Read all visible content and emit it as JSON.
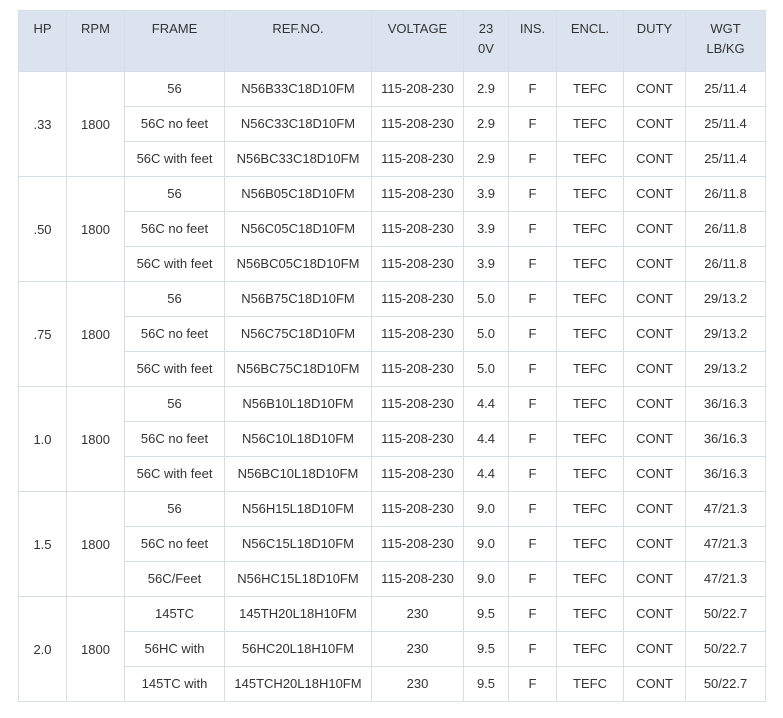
{
  "headers": [
    "HP",
    "RPM",
    "FRAME",
    "REF.NO.",
    "VOLTAGE",
    "230V",
    "INS.",
    "ENCL.",
    "DUTY",
    "WGT LB/KG"
  ],
  "header_display": {
    "hp": "HP",
    "rpm": "RPM",
    "frame": "FRAME",
    "ref": "REF.NO.",
    "voltage": "VOLTAGE",
    "amps_line1": "23",
    "amps_line2": "0V",
    "ins": "INS.",
    "encl": "ENCL.",
    "duty": "DUTY",
    "wgt_line1": "WGT",
    "wgt_line2": "LB/KG"
  },
  "groups": [
    {
      "hp": ".33",
      "rpm": "1800",
      "rows": [
        {
          "frame": "56",
          "ref": "N56B33C18D10FM",
          "voltage": "115-208-230",
          "amps": "2.9",
          "ins": "F",
          "encl": "TEFC",
          "duty": "CONT",
          "wgt": "25/11.4"
        },
        {
          "frame": "56C no feet",
          "ref": "N56C33C18D10FM",
          "voltage": "115-208-230",
          "amps": "2.9",
          "ins": "F",
          "encl": "TEFC",
          "duty": "CONT",
          "wgt": "25/11.4"
        },
        {
          "frame": "56C with feet",
          "ref": "N56BC33C18D10FM",
          "voltage": "115-208-230",
          "amps": "2.9",
          "ins": "F",
          "encl": "TEFC",
          "duty": "CONT",
          "wgt": "25/11.4"
        }
      ]
    },
    {
      "hp": ".50",
      "rpm": "1800",
      "rows": [
        {
          "frame": "56",
          "ref": "N56B05C18D10FM",
          "voltage": "115-208-230",
          "amps": "3.9",
          "ins": "F",
          "encl": "TEFC",
          "duty": "CONT",
          "wgt": "26/11.8"
        },
        {
          "frame": "56C no feet",
          "ref": "N56C05C18D10FM",
          "voltage": "115-208-230",
          "amps": "3.9",
          "ins": "F",
          "encl": "TEFC",
          "duty": "CONT",
          "wgt": "26/11.8"
        },
        {
          "frame": "56C with feet",
          "ref": "N56BC05C18D10FM",
          "voltage": "115-208-230",
          "amps": "3.9",
          "ins": "F",
          "encl": "TEFC",
          "duty": "CONT",
          "wgt": "26/11.8"
        }
      ]
    },
    {
      "hp": ".75",
      "rpm": "1800",
      "rows": [
        {
          "frame": "56",
          "ref": "N56B75C18D10FM",
          "voltage": "115-208-230",
          "amps": "5.0",
          "ins": "F",
          "encl": "TEFC",
          "duty": "CONT",
          "wgt": "29/13.2"
        },
        {
          "frame": "56C no feet",
          "ref": "N56C75C18D10FM",
          "voltage": "115-208-230",
          "amps": "5.0",
          "ins": "F",
          "encl": "TEFC",
          "duty": "CONT",
          "wgt": "29/13.2"
        },
        {
          "frame": "56C with feet",
          "ref": "N56BC75C18D10FM",
          "voltage": "115-208-230",
          "amps": "5.0",
          "ins": "F",
          "encl": "TEFC",
          "duty": "CONT",
          "wgt": "29/13.2"
        }
      ]
    },
    {
      "hp": "1.0",
      "rpm": "1800",
      "rows": [
        {
          "frame": "56",
          "ref": "N56B10L18D10FM",
          "voltage": "115-208-230",
          "amps": "4.4",
          "ins": "F",
          "encl": "TEFC",
          "duty": "CONT",
          "wgt": "36/16.3"
        },
        {
          "frame": "56C no feet",
          "ref": "N56C10L18D10FM",
          "voltage": "115-208-230",
          "amps": "4.4",
          "ins": "F",
          "encl": "TEFC",
          "duty": "CONT",
          "wgt": "36/16.3"
        },
        {
          "frame": "56C with feet",
          "ref": "N56BC10L18D10FM",
          "voltage": "115-208-230",
          "amps": "4.4",
          "ins": "F",
          "encl": "TEFC",
          "duty": "CONT",
          "wgt": "36/16.3"
        }
      ]
    },
    {
      "hp": "1.5",
      "rpm": "1800",
      "rows": [
        {
          "frame": "56",
          "ref": "N56H15L18D10FM",
          "voltage": "115-208-230",
          "amps": "9.0",
          "ins": "F",
          "encl": "TEFC",
          "duty": "CONT",
          "wgt": "47/21.3"
        },
        {
          "frame": "56C no feet",
          "ref": "N56C15L18D10FM",
          "voltage": "115-208-230",
          "amps": "9.0",
          "ins": "F",
          "encl": "TEFC",
          "duty": "CONT",
          "wgt": "47/21.3"
        },
        {
          "frame": "56C/Feet",
          "ref": "N56HC15L18D10FM",
          "voltage": "115-208-230",
          "amps": "9.0",
          "ins": "F",
          "encl": "TEFC",
          "duty": "CONT",
          "wgt": "47/21.3"
        }
      ]
    },
    {
      "hp": "2.0",
      "rpm": "1800",
      "rows": [
        {
          "frame": "145TC",
          "ref": "145TH20L18H10FM",
          "voltage": "230",
          "amps": "9.5",
          "ins": "F",
          "encl": "TEFC",
          "duty": "CONT",
          "wgt": "50/22.7"
        },
        {
          "frame": "56HC with",
          "ref": "56HC20L18H10FM",
          "voltage": "230",
          "amps": "9.5",
          "ins": "F",
          "encl": "TEFC",
          "duty": "CONT",
          "wgt": "50/22.7"
        },
        {
          "frame": "145TC with",
          "ref": "145TCH20L18H10FM",
          "voltage": "230",
          "amps": "9.5",
          "ins": "F",
          "encl": "TEFC",
          "duty": "CONT",
          "wgt": "50/22.7"
        }
      ]
    }
  ],
  "colors": {
    "header_bg": "#dbe3ee",
    "border": "#d7dde6",
    "text": "#333333"
  }
}
